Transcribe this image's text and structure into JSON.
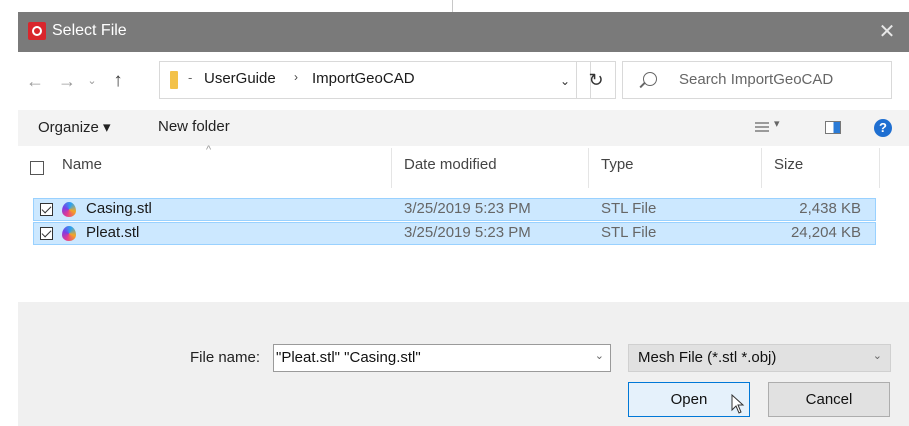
{
  "window": {
    "title": "Select File",
    "close_symbol": "✕"
  },
  "address": {
    "crumb_sep": "-",
    "crumbs": [
      "UserGuide",
      "ImportGeoCAD"
    ],
    "crumb_arrow": "›",
    "dropdown": "⌄"
  },
  "nav": {
    "back": "←",
    "forward": "→",
    "recent": "⌄",
    "up": "↑",
    "refresh": "↻"
  },
  "search": {
    "placeholder": "Search ImportGeoCAD"
  },
  "commandbar": {
    "organize": "Organize ▾",
    "new_folder": "New folder",
    "view_dd": "▾",
    "help": "?"
  },
  "columns": {
    "name": "Name",
    "date": "Date modified",
    "type": "Type",
    "size": "Size",
    "sort_caret": "^"
  },
  "files": [
    {
      "name": "Casing.stl",
      "date": "3/25/2019 5:23 PM",
      "type": "STL File",
      "size": "2,438 KB"
    },
    {
      "name": "Pleat.stl",
      "date": "3/25/2019 5:23 PM",
      "type": "STL File",
      "size": "24,204 KB"
    }
  ],
  "footer": {
    "filename_label": "File name:",
    "filename_value": "\"Pleat.stl\" \"Casing.stl\"",
    "filename_dd": "⌄",
    "filetype_value": "Mesh File (*.stl *.obj)",
    "filetype_dd": "⌄",
    "open": "Open",
    "cancel": "Cancel"
  },
  "colors": {
    "titlebar": "#7a7a7a",
    "selection": "#cce8ff",
    "accent": "#0078d7",
    "app_icon": "#d9262c"
  }
}
